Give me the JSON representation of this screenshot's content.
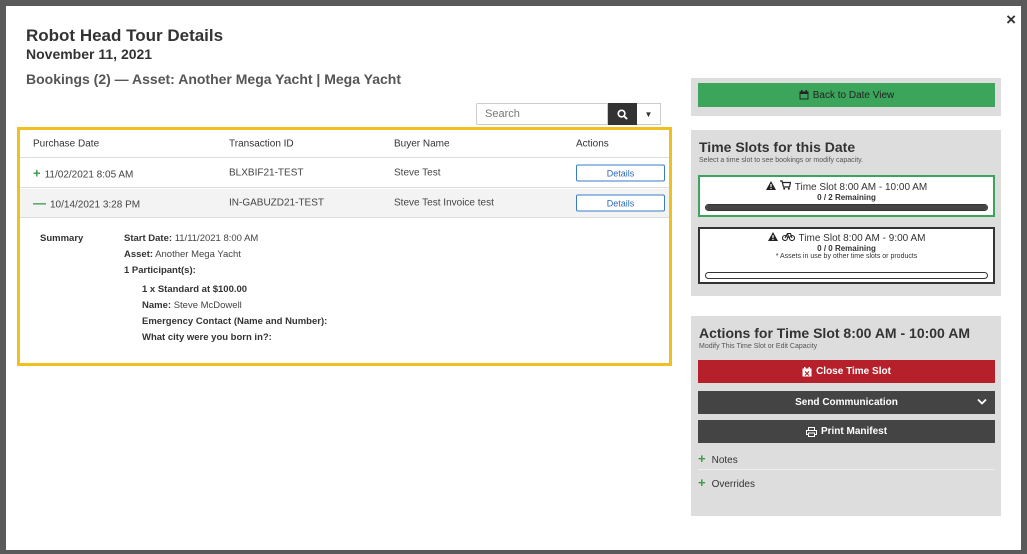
{
  "modal": {
    "title": "Robot Head Tour Details",
    "date": "November 11, 2021",
    "bookings_heading": "Bookings (2) — Asset: Another Mega Yacht | Mega Yacht",
    "close_glyph": "×"
  },
  "search": {
    "placeholder": "Search"
  },
  "table": {
    "headers": [
      "Purchase Date",
      "Transaction ID",
      "Buyer Name",
      "Actions"
    ],
    "rows": [
      {
        "sign": "+",
        "purchase_date": "11/02/2021 8:05 AM",
        "transaction_id": "BLXBIF21-TEST",
        "buyer_name": "Steve Test",
        "action": "Details"
      },
      {
        "sign": "—",
        "purchase_date": "10/14/2021 3:28 PM",
        "transaction_id": "IN-GABUZD21-TEST",
        "buyer_name": "Steve Test Invoice test",
        "action": "Details"
      }
    ],
    "summary": {
      "label": "Summary",
      "start_date_label": "Start Date:",
      "start_date_value": "11/11/2021 8:00 AM",
      "asset_label": "Asset:",
      "asset_value": "Another Mega Yacht",
      "participants": "1 Participant(s):",
      "ticket": "1 x Standard at $100.00",
      "name_label": "Name:",
      "name_value": "Steve McDowell",
      "emergency": "Emergency Contact (Name and Number):",
      "city": "What city were you born in?:"
    }
  },
  "right": {
    "back_button": "Back to Date View",
    "slots_title": "Time Slots for this Date",
    "slots_subtitle": "Select a time slot to see bookings or modify capacity.",
    "slots": [
      {
        "time": "Time Slot 8:00 AM - 10:00 AM",
        "remaining": "0 / 2 Remaining",
        "note": "",
        "fill": 1.0,
        "icon": "cart-icon"
      },
      {
        "time": "Time Slot 8:00 AM - 9:00 AM",
        "remaining": "0 / 0 Remaining",
        "note": "* Assets in use by other time slots or products",
        "fill": 0.0,
        "icon": "bicycle-icon"
      }
    ],
    "actions_title": "Actions for Time Slot 8:00 AM - 10:00 AM",
    "actions_subtitle": "Modify This Time Slot or Edit Capacity",
    "close_slot": "Close Time Slot",
    "send_comm": "Send Communication",
    "print_manifest": "Print Manifest",
    "notes": "Notes",
    "overrides": "Overrides"
  },
  "colors": {
    "green": "#3ca55c",
    "red": "#b5202a",
    "dark": "#444444",
    "highlight": "#f0c020"
  }
}
